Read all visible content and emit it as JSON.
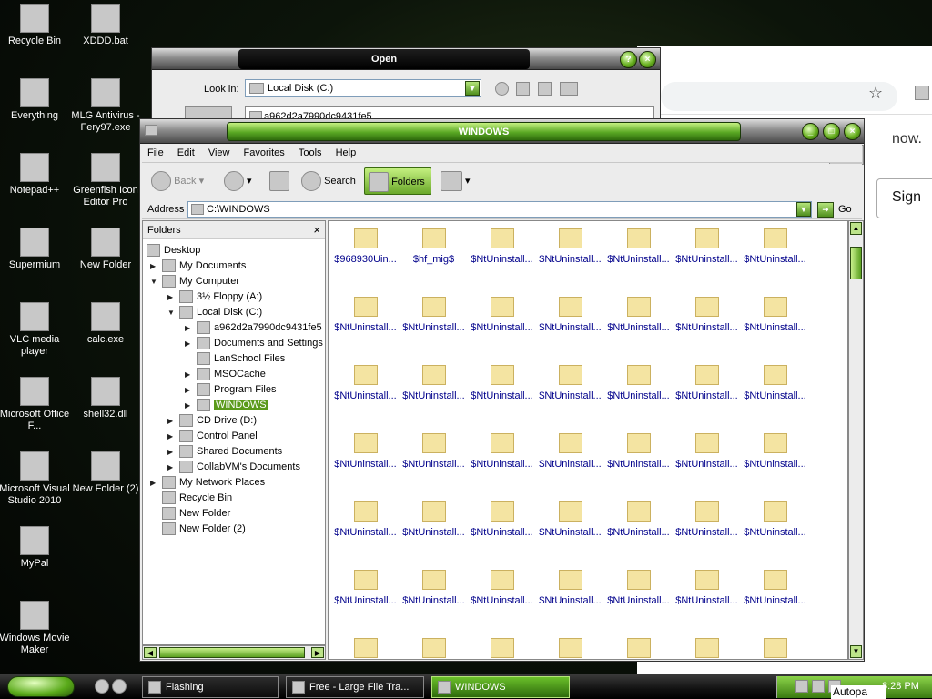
{
  "desktop": {
    "icons": [
      {
        "label": "Recycle Bin",
        "icon": "recycle-bin-icon"
      },
      {
        "label": "XDDD.bat",
        "icon": "batch-file-icon"
      },
      {
        "label": "Everything",
        "icon": "everything-search-icon"
      },
      {
        "label": "MLG Antivirus - Fery97.exe",
        "icon": "exe-app-icon"
      },
      {
        "label": "Notepad++",
        "icon": "notepad-plus-icon"
      },
      {
        "label": "Greenfish Icon Editor Pro",
        "icon": "icon-editor-icon"
      },
      {
        "label": "Supermium",
        "icon": "browser-icon"
      },
      {
        "label": "New Folder",
        "icon": "folder-icon"
      },
      {
        "label": "VLC media player",
        "icon": "vlc-icon"
      },
      {
        "label": "calc.exe",
        "icon": "calculator-icon"
      },
      {
        "label": "Microsoft Office F...",
        "icon": "office-icon"
      },
      {
        "label": "shell32.dll",
        "icon": "dll-file-icon"
      },
      {
        "label": "Microsoft Visual Studio 2010",
        "icon": "visual-studio-icon"
      },
      {
        "label": "New Folder (2)",
        "icon": "folder-icon"
      },
      {
        "label": "MyPal",
        "icon": "mypal-browser-icon"
      },
      {
        "label": "Windows Movie Maker",
        "icon": "movie-maker-icon"
      }
    ]
  },
  "browser": {
    "now_text": "now.",
    "sign_label": "Sign"
  },
  "open_dialog": {
    "title": "Open",
    "look_in_label": "Look in:",
    "look_in_value": "Local Disk (C:)",
    "first_item": "a962d2a7990dc9431fe5"
  },
  "explorer": {
    "title": "WINDOWS",
    "menu": [
      "File",
      "Edit",
      "View",
      "Favorites",
      "Tools",
      "Help"
    ],
    "toolbar": {
      "back": "Back",
      "search": "Search",
      "folders": "Folders"
    },
    "address_label": "Address",
    "address_value": "C:\\WINDOWS",
    "go_label": "Go",
    "folders_pane_title": "Folders",
    "tree": [
      {
        "label": "Desktop"
      },
      {
        "label": "My Documents"
      },
      {
        "label": "My Computer"
      },
      {
        "label": "3½ Floppy (A:)"
      },
      {
        "label": "Local Disk (C:)"
      },
      {
        "label": "a962d2a7990dc9431fe5"
      },
      {
        "label": "Documents and Settings"
      },
      {
        "label": "LanSchool Files"
      },
      {
        "label": "MSOCache"
      },
      {
        "label": "Program Files"
      },
      {
        "label": "WINDOWS"
      },
      {
        "label": "CD Drive (D:)"
      },
      {
        "label": "Control Panel"
      },
      {
        "label": "Shared Documents"
      },
      {
        "label": "CollabVM's Documents"
      },
      {
        "label": "My Network Places"
      },
      {
        "label": "Recycle Bin"
      },
      {
        "label": "New Folder"
      },
      {
        "label": "New Folder (2)"
      }
    ],
    "files": [
      "$968930Uin...",
      "$hf_mig$",
      "$NtUninstall...",
      "$NtUninstall...",
      "$NtUninstall...",
      "$NtUninstall...",
      "$NtUninstall...",
      "$NtUninstall...",
      "$NtUninstall...",
      "$NtUninstall...",
      "$NtUninstall...",
      "$NtUninstall...",
      "$NtUninstall...",
      "$NtUninstall...",
      "$NtUninstall...",
      "$NtUninstall...",
      "$NtUninstall...",
      "$NtUninstall...",
      "$NtUninstall...",
      "$NtUninstall...",
      "$NtUninstall...",
      "$NtUninstall...",
      "$NtUninstall...",
      "$NtUninstall...",
      "$NtUninstall...",
      "$NtUninstall...",
      "$NtUninstall...",
      "$NtUninstall...",
      "$NtUninstall...",
      "$NtUninstall...",
      "$NtUninstall...",
      "$NtUninstall...",
      "$NtUninstall...",
      "$NtUninstall...",
      "$NtUninstall...",
      "$NtUninstall...",
      "$NtUninstall...",
      "$NtUninstall...",
      "$NtUninstall...",
      "$NtUninstall...",
      "$NtUninstall...",
      "$NtUninstall...",
      "",
      "",
      "",
      "",
      "",
      "",
      ""
    ]
  },
  "taskbar": {
    "buttons": [
      {
        "label": "Flashing"
      },
      {
        "label": "Free - Large File Tra..."
      },
      {
        "label": "WINDOWS"
      }
    ],
    "clock": "8:28 PM",
    "autopa": "Autopa"
  }
}
